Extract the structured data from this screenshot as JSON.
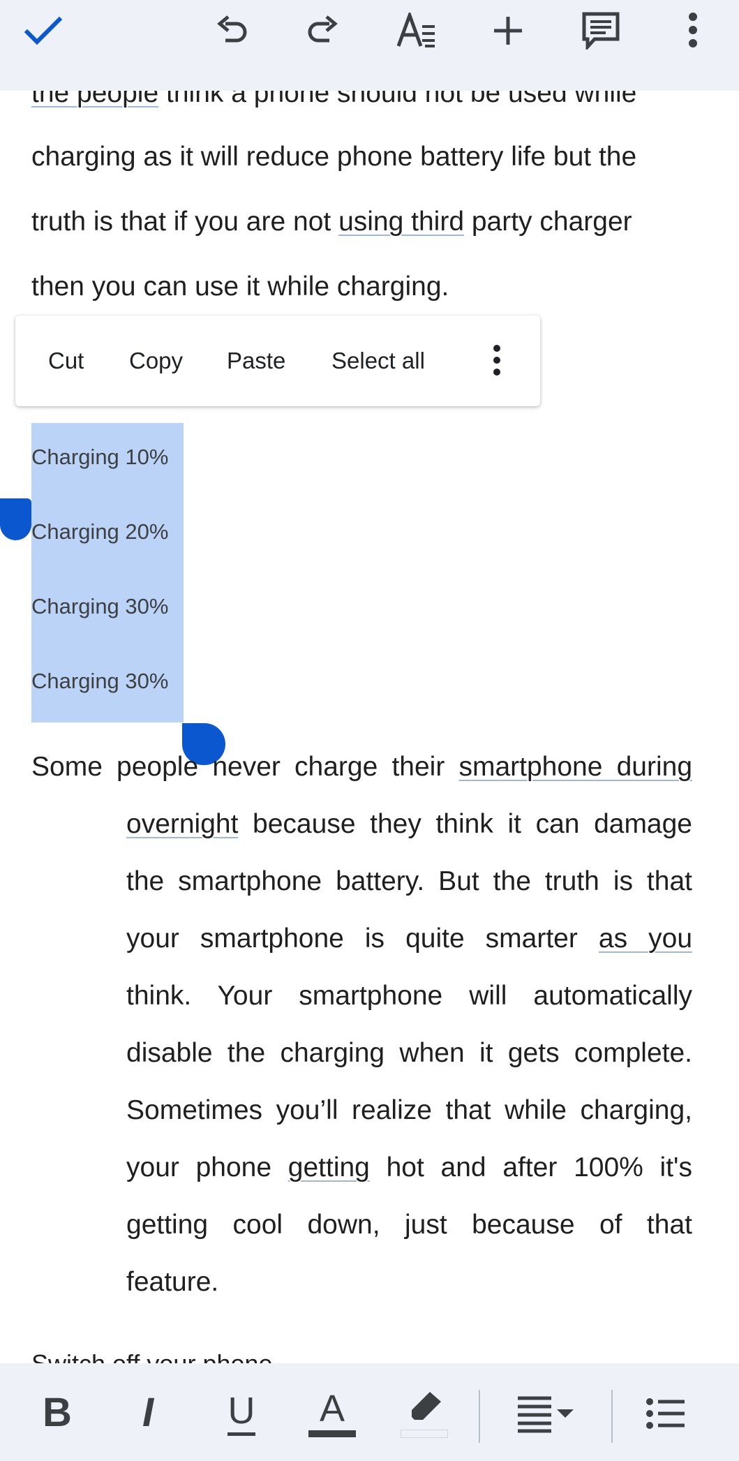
{
  "toolbar": {
    "done_icon": "check-icon",
    "undo_icon": "undo-icon",
    "redo_icon": "redo-icon",
    "text_format_icon": "text-format-icon",
    "insert_icon": "plus-icon",
    "comment_icon": "comment-icon",
    "more_icon": "more-vert-icon",
    "accent_color": "#0b57d0"
  },
  "document": {
    "para1": {
      "line0": {
        "u": "the people",
        "rest": " think a phone should not be used while"
      },
      "line1": "charging as it will reduce phone battery life but the",
      "line2": {
        "pre": "truth is that if you are not ",
        "u": "using third",
        "post": " party charger"
      },
      "line3": "then you can use it while charging."
    },
    "selected_lines": [
      "Charging 10%",
      "Charging 20%",
      "Charging 30%",
      "Charging 30%"
    ],
    "para2": {
      "l1": {
        "pre": "Some people never charge their ",
        "u": "smartphone during"
      },
      "l2": {
        "u": "overnight",
        "post": " because they think it can damage"
      },
      "l3": "the smartphone battery. But the truth is that",
      "l4": {
        "pre": "your smartphone is quite smarter ",
        "u": "as you"
      },
      "l5": "think.  Your smartphone will automatically",
      "l6": "disable the charging when it gets complete.",
      "l7": "Sometimes you’ll realize that while charging,",
      "l8": {
        "pre": "your phone ",
        "u": "getting",
        "post": " hot and after 100% it's"
      },
      "l9": "getting cool down, just because of that",
      "l10": "feature."
    },
    "next_heading": "Switch off your phone"
  },
  "context_menu": {
    "cut": "Cut",
    "copy": "Copy",
    "paste": "Paste",
    "select_all": "Select all",
    "more_icon": "more-vert-icon"
  },
  "format_bar": {
    "bold": "B",
    "italic": "I",
    "underline": "U",
    "text_color": "A",
    "highlight_icon": "highlighter-icon",
    "align_icon": "align-justify-icon",
    "list_icon": "bulleted-list-icon"
  },
  "colors": {
    "selection": "#bcd3f8",
    "handle": "#0b57d0",
    "toolbar_bg": "#eef1f8"
  }
}
